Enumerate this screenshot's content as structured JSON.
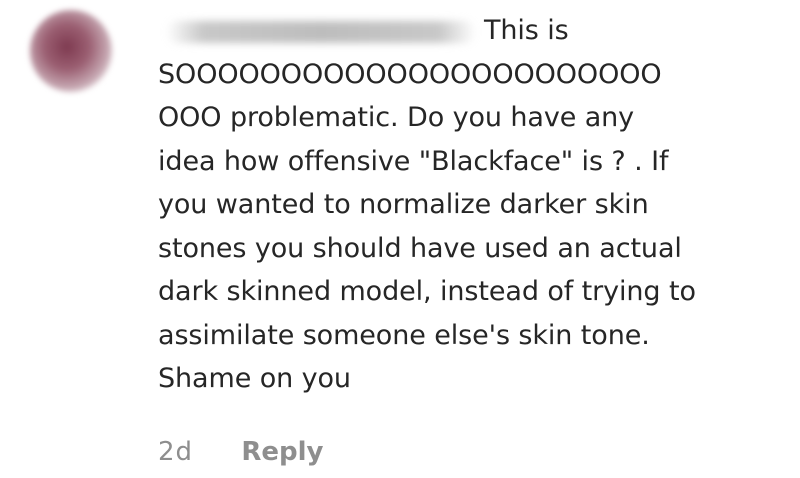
{
  "comment": {
    "text_lines": [
      "This is",
      "SOOOOOOOOOOOOOOOOOOOOOOO",
      "OOO problematic. Do you have any",
      "idea how offensive \"Blackface\" is ? . If",
      "you wanted to normalize darker skin",
      "stones you should have used an actual",
      "dark skinned model, instead of trying to",
      "assimilate someone else's skin tone.",
      "Shame on you"
    ],
    "timestamp": "2d",
    "reply_label": "Reply"
  }
}
